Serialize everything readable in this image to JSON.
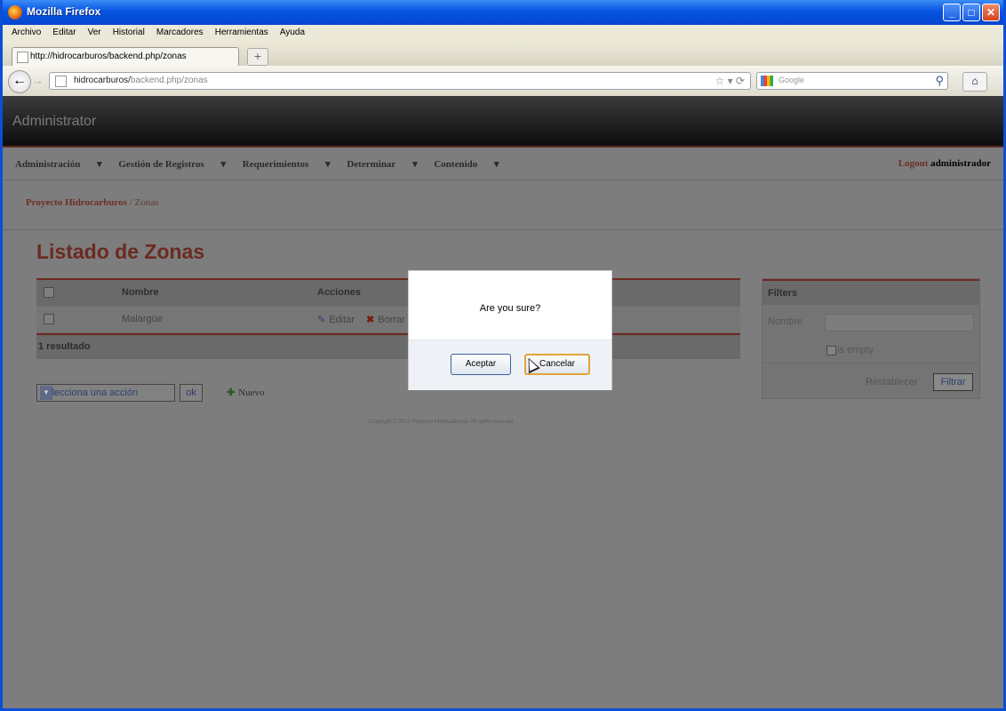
{
  "window": {
    "title": "Mozilla Firefox"
  },
  "browser": {
    "menu": [
      "Archivo",
      "Editar",
      "Ver",
      "Historial",
      "Marcadores",
      "Herramientas",
      "Ayuda"
    ],
    "tab_title": "http://hidrocarburos/backend.php/zonas",
    "url_host": "hidrocarburos/",
    "url_path": "backend.php/zonas",
    "search_placeholder": "Google"
  },
  "admin": {
    "brand": "Administrator",
    "nav": [
      "Administración",
      "Gestión de Registros",
      "Requerimientos",
      "Determinar",
      "Contenido"
    ],
    "logout_link": "Logout",
    "logout_user": "administrador"
  },
  "breadcrumb": {
    "link": "Proyecto Hidrocarburos",
    "sep": " / ",
    "current": "Zonas"
  },
  "page_title": "Listado de Zonas",
  "table": {
    "columns": [
      "Nombre",
      "Acciones"
    ],
    "rows": [
      {
        "nombre": "Malargüe",
        "edit": "Editar",
        "delete": "Borrar"
      }
    ],
    "footer": "1 resultado"
  },
  "batch": {
    "select_value": "Selecciona una acción",
    "ok_label": "ok",
    "new_label": "Nuevo"
  },
  "filters": {
    "title": "Filters",
    "field_label": "Nombre",
    "empty_label": "is empty",
    "reset_label": "Restablecer",
    "submit_label": "Filtrar"
  },
  "copyright": "Copyright © 2012 Proyecto Hidrocarburos. All rights reserved.",
  "dialog": {
    "message": "Are you sure?",
    "accept": "Aceptar",
    "cancel": "Cancelar"
  }
}
